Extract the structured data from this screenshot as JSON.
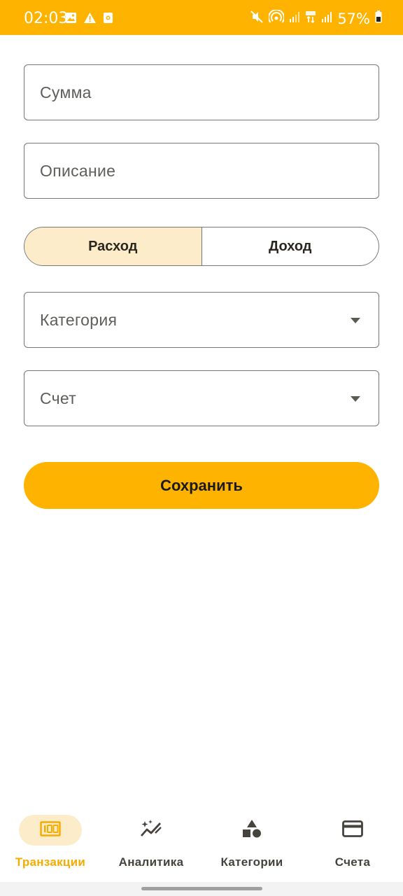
{
  "status_bar": {
    "time": "02:03",
    "battery": "57%",
    "background_color": "#fdb300"
  },
  "form": {
    "amount_placeholder": "Сумма",
    "description_placeholder": "Описание",
    "type_toggle": {
      "expense_label": "Расход",
      "income_label": "Доход",
      "selected": "expense"
    },
    "category_placeholder": "Категория",
    "account_placeholder": "Счет",
    "save_label": "Сохранить"
  },
  "bottom_nav": {
    "items": [
      {
        "label": "Транзакции",
        "icon": "transactions-icon",
        "active": true
      },
      {
        "label": "Аналитика",
        "icon": "analytics-icon",
        "active": false
      },
      {
        "label": "Категории",
        "icon": "categories-icon",
        "active": false
      },
      {
        "label": "Счета",
        "icon": "card-icon",
        "active": false
      }
    ]
  },
  "colors": {
    "accent": "#fdb300",
    "selected_bg": "#fdecc9"
  }
}
